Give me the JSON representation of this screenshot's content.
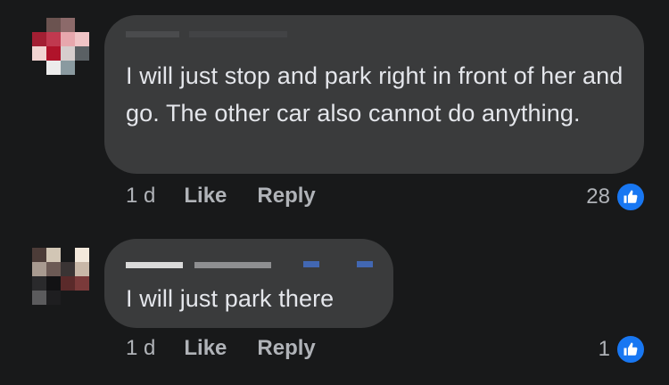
{
  "comments": [
    {
      "text": "I will just stop and park right in front of her and go. The other car also cannot do anything.",
      "time": "1 d",
      "like_label": "Like",
      "reply_label": "Reply",
      "reaction_count": "28",
      "reaction_icon": "thumbs-up-icon"
    },
    {
      "text": "I will just park there",
      "time": "1 d",
      "like_label": "Like",
      "reply_label": "Reply",
      "reaction_count": "1",
      "reaction_icon": "thumbs-up-icon"
    }
  ],
  "colors": {
    "background": "#18191a",
    "bubble": "#3a3b3c",
    "text": "#e4e6eb",
    "secondary_text": "#b0b3b8",
    "like_blue": "#1877f2"
  }
}
